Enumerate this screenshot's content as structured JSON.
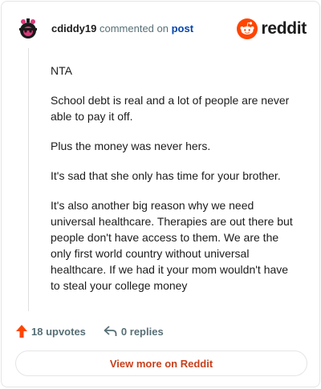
{
  "header": {
    "username": "cdiddy19",
    "action_text": "commented on",
    "target_link": "post",
    "brand_name": "reddit"
  },
  "comment": {
    "paragraphs": [
      "NTA",
      "School debt is real and a lot of people are never able to pay it off.",
      "Plus the money was never hers.",
      "It's sad that she only has time for your brother.",
      "It's also another big reason why we need universal healthcare. Therapies are out there but people don't have access to them. We are the only first world country without universal healthcare. If we had it your mom wouldn't have to steal your college money"
    ]
  },
  "actions": {
    "upvotes_label": "18 upvotes",
    "replies_label": "0 replies"
  },
  "footer": {
    "view_more_label": "View more on Reddit"
  },
  "colors": {
    "accent": "#ff4500",
    "link": "#0045ac",
    "muted": "#576f76",
    "view_more": "#c8401b",
    "avatar_bg": "#1a1a1a",
    "avatar_accent": "#d93a7a"
  },
  "icons": {
    "avatar": "snoo-avatar-icon",
    "brand": "reddit-logo-icon",
    "upvote": "upvote-arrow-icon",
    "reply": "reply-arrow-icon"
  }
}
